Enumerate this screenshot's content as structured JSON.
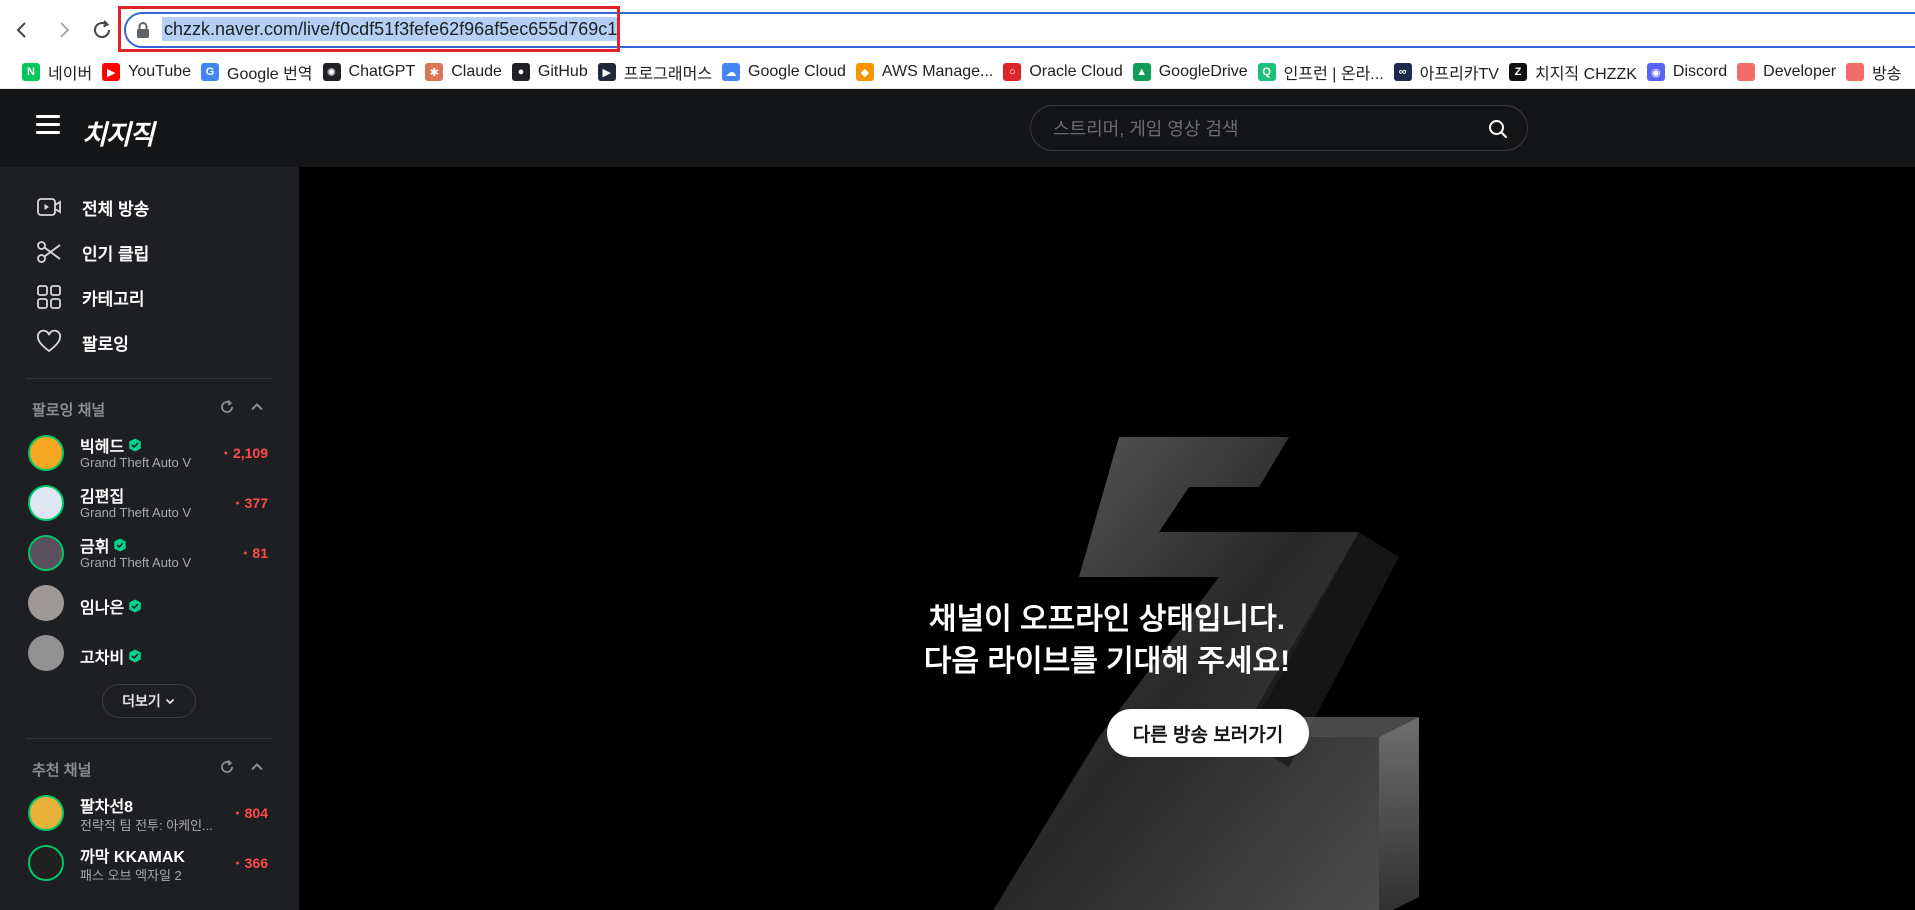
{
  "browser": {
    "url": "chzzk.naver.com/live/f0cdf51f3fefe62f96af5ec655d769c1",
    "bookmarks": [
      {
        "label": "네이버",
        "icon": "naver-icon",
        "color": "#03c75a",
        "glyph": "N"
      },
      {
        "label": "YouTube",
        "icon": "youtube-icon",
        "color": "#ff0000",
        "glyph": "▶"
      },
      {
        "label": "Google 번역",
        "icon": "google-translate-icon",
        "color": "#4285f4",
        "glyph": "G"
      },
      {
        "label": "ChatGPT",
        "icon": "chatgpt-icon",
        "color": "#202124",
        "glyph": "✺"
      },
      {
        "label": "Claude",
        "icon": "claude-icon",
        "color": "#d97757",
        "glyph": "✱"
      },
      {
        "label": "GitHub",
        "icon": "github-icon",
        "color": "#202124",
        "glyph": "●"
      },
      {
        "label": "프로그래머스",
        "icon": "programmers-icon",
        "color": "#1e2a3a",
        "glyph": "▶"
      },
      {
        "label": "Google Cloud",
        "icon": "google-cloud-icon",
        "color": "#4285f4",
        "glyph": "☁"
      },
      {
        "label": "AWS Manage...",
        "icon": "aws-icon",
        "color": "#f79400",
        "glyph": "◆"
      },
      {
        "label": "Oracle Cloud",
        "icon": "oracle-icon",
        "color": "#e0242c",
        "glyph": "○"
      },
      {
        "label": "GoogleDrive",
        "icon": "google-drive-icon",
        "color": "#0f9d58",
        "glyph": "▲"
      },
      {
        "label": "인프런 | 온라...",
        "icon": "inflearn-icon",
        "color": "#1dc078",
        "glyph": "Q"
      },
      {
        "label": "아프리카TV",
        "icon": "afreecatv-icon",
        "color": "#1d2a4d",
        "glyph": "∞"
      },
      {
        "label": "치지직 CHZZK",
        "icon": "chzzk-icon",
        "color": "#111111",
        "glyph": "Z"
      },
      {
        "label": "Discord",
        "icon": "discord-icon",
        "color": "#5865f2",
        "glyph": "◉"
      },
      {
        "label": "Developer",
        "icon": "folder-icon",
        "color": "#f26b6b",
        "glyph": ""
      },
      {
        "label": "방송",
        "icon": "folder-icon",
        "color": "#f26b6b",
        "glyph": ""
      }
    ]
  },
  "header": {
    "logo": "치지직",
    "search_placeholder": "스트리머, 게임 영상 검색"
  },
  "sidebar": {
    "menu": [
      {
        "label": "전체 방송",
        "icon": "live-video-icon"
      },
      {
        "label": "인기 클립",
        "icon": "scissors-icon"
      },
      {
        "label": "카테고리",
        "icon": "grid-icon"
      },
      {
        "label": "팔로잉",
        "icon": "heart-icon"
      }
    ],
    "following_title": "팔로잉 채널",
    "following": [
      {
        "name": "빅헤드",
        "category": "Grand Theft Auto V",
        "viewers": "2,109",
        "verified": true,
        "live": true,
        "avatar_color": "#f5a623"
      },
      {
        "name": "김편집",
        "category": "Grand Theft Auto V",
        "viewers": "377",
        "verified": false,
        "live": true,
        "avatar_color": "#dfe6f2"
      },
      {
        "name": "금휘",
        "category": "Grand Theft Auto V",
        "viewers": "81",
        "verified": true,
        "live": true,
        "avatar_color": "#5a4f5c"
      },
      {
        "name": "임나은",
        "category": "",
        "viewers": "",
        "verified": true,
        "live": false,
        "avatar_color": "#c9c2bd"
      },
      {
        "name": "고차비",
        "category": "",
        "viewers": "",
        "verified": true,
        "live": false,
        "avatar_color": "#b9b9b9"
      }
    ],
    "more_label": "더보기",
    "recommended_title": "추천 채널",
    "recommended": [
      {
        "name": "팔차선8",
        "category": "전략적 팀 전투: 아케인...",
        "viewers": "804",
        "verified": false,
        "live": true,
        "avatar_color": "#e8b23a"
      },
      {
        "name": "까막 KKAMAK",
        "category": "패스 오브 엑자일 2",
        "viewers": "366",
        "verified": false,
        "live": true,
        "avatar_color": "#202020"
      }
    ]
  },
  "player": {
    "offline_line1": "채널이 오프라인 상태입니다.",
    "offline_line2": "다음 라이브를 기대해 주세요!",
    "other_broadcast_label": "다른 방송 보러가기"
  }
}
